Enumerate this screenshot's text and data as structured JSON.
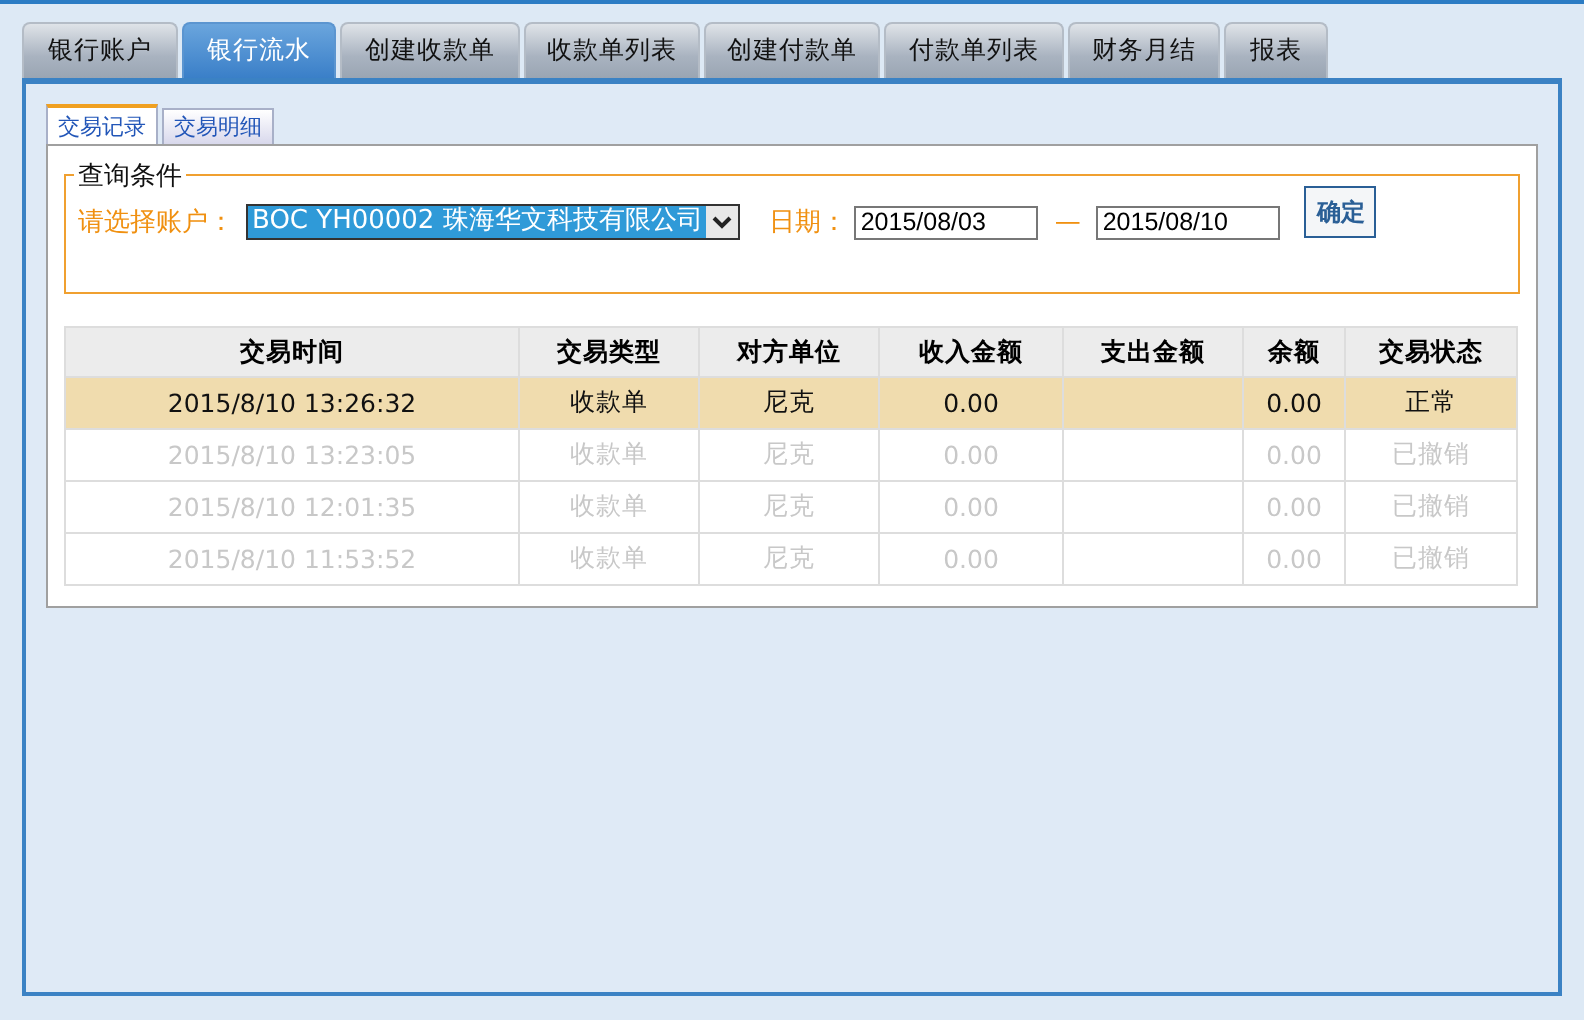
{
  "tabs": [
    {
      "label": "银行账户",
      "selected": false
    },
    {
      "label": "银行流水",
      "selected": true
    },
    {
      "label": "创建收款单",
      "selected": false
    },
    {
      "label": "收款单列表",
      "selected": false
    },
    {
      "label": "创建付款单",
      "selected": false
    },
    {
      "label": "付款单列表",
      "selected": false
    },
    {
      "label": "财务月结",
      "selected": false
    },
    {
      "label": "报表",
      "selected": false
    }
  ],
  "subtabs": [
    {
      "label": "交易记录",
      "selected": true
    },
    {
      "label": "交易明细",
      "selected": false
    }
  ],
  "query": {
    "legend": "查询条件",
    "account_label": "请选择账户：",
    "account": "BOC YH00002 珠海华文科技有限公司",
    "date_label": "日期：",
    "date_from": "2015/08/03",
    "separator": "—",
    "date_to": "2015/08/10",
    "confirm": "确定"
  },
  "table": {
    "columns": [
      "交易时间",
      "交易类型",
      "对方单位",
      "收入金额",
      "支出金额",
      "余额",
      "交易状态"
    ],
    "rows": [
      {
        "selected": true,
        "voided": false,
        "cells": [
          "2015/8/10 13:26:32",
          "收款单",
          "尼克",
          "0.00",
          "",
          "0.00",
          "正常"
        ]
      },
      {
        "selected": false,
        "voided": true,
        "cells": [
          "2015/8/10 13:23:05",
          "收款单",
          "尼克",
          "0.00",
          "",
          "0.00",
          "已撤销"
        ]
      },
      {
        "selected": false,
        "voided": true,
        "cells": [
          "2015/8/10 12:01:35",
          "收款单",
          "尼克",
          "0.00",
          "",
          "0.00",
          "已撤销"
        ]
      },
      {
        "selected": false,
        "voided": true,
        "cells": [
          "2015/8/10 11:53:52",
          "收款单",
          "尼克",
          "0.00",
          "",
          "0.00",
          "已撤销"
        ]
      }
    ]
  }
}
